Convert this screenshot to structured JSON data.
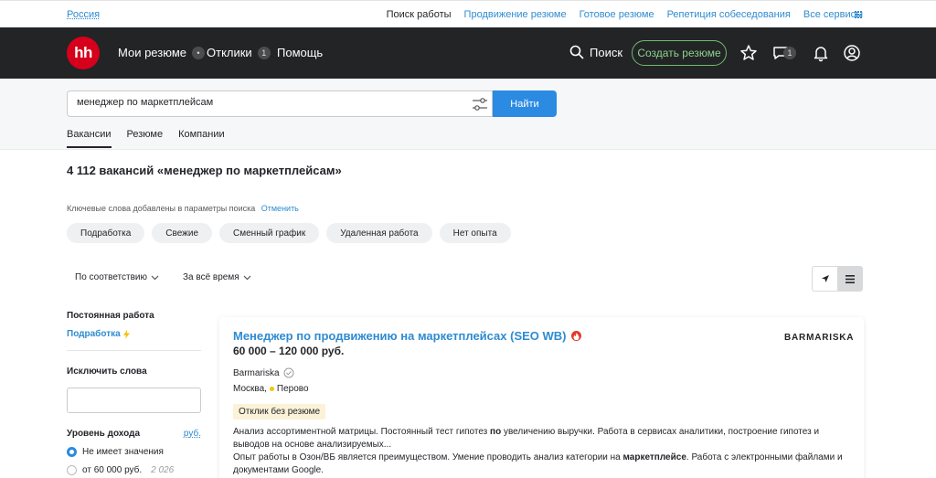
{
  "topbar": {
    "region": "Россия",
    "links": [
      {
        "label": "Поиск работы",
        "current": true
      },
      {
        "label": "Продвижение резюме",
        "current": false
      },
      {
        "label": "Готовое резюме",
        "current": false
      },
      {
        "label": "Репетиция собеседования",
        "current": false
      },
      {
        "label": "Все сервисы",
        "current": false
      }
    ]
  },
  "nav": {
    "logo": "hh",
    "my_resumes": "Мои резюме",
    "my_resumes_badge": "•",
    "responses": "Отклики",
    "responses_badge": "1",
    "help": "Помощь",
    "search": "Поиск",
    "create_resume": "Создать резюме",
    "chat_badge": "1"
  },
  "search": {
    "query": "менеджер по маркетплейсам",
    "button": "Найти",
    "tabs": [
      "Вакансии",
      "Резюме",
      "Компании"
    ],
    "active_tab": "Вакансии"
  },
  "results": {
    "title": "4 112 вакансий «менеджер по маркетплейсам»",
    "keywords_note": "Ключевые слова добавлены в параметры поиска",
    "keywords_cancel": "Отменить",
    "chips": [
      "Подработка",
      "Свежие",
      "Сменный график",
      "Удаленная работа",
      "Нет опыта"
    ],
    "sort": "По соответствию",
    "period": "За всё время"
  },
  "sidebar": {
    "permanent_heading": "Постоянная работа",
    "parttime_link": "Подработка",
    "exclude_heading": "Исключить слова",
    "exclude_value": "",
    "income_heading": "Уровень дохода",
    "income_currency": "руб.",
    "income_options": [
      {
        "label": "Не имеет значения",
        "count": "",
        "selected": true
      },
      {
        "label": "от 60 000 руб.",
        "count": "2 026",
        "selected": false
      }
    ]
  },
  "vacancy": {
    "title": "Менеджер по продвижению на маркетплейсах (SEO WB)",
    "salary": "60 000 – 120 000 руб.",
    "company": "Barmariska",
    "company_logo_text": "BARMARISKA",
    "city": "Москва,",
    "metro": "Перово",
    "badge": "Отклик без резюме",
    "desc1_a": "Анализ ассортиментной матрицы. Постоянный тест гипотез ",
    "desc1_b": "по",
    "desc1_c": " увеличению выручки. Работа в сервисах аналитики, построение гипотез и выводов на основе анализируемых...",
    "desc2_a": "Опыт работы в Озон/ВБ является преимуществом. Умение проводить анализ категории на ",
    "desc2_b": "маркетплейсе",
    "desc2_c": ". Работа с электронными файлами и документами Google."
  },
  "colors": {
    "brand_red": "#d6001c",
    "link_blue": "#2e8bd1",
    "button_blue": "#2b8ae2",
    "nav_bg": "#222426",
    "create_green": "#6ebd6e"
  },
  "icons": [
    "grid-icon",
    "search-icon",
    "star-icon",
    "chat-icon",
    "bell-icon",
    "user-icon",
    "filter-icon",
    "chevron-down-icon",
    "location-arrow-icon",
    "list-icon",
    "fire-icon",
    "verified-icon",
    "lightning-icon"
  ]
}
